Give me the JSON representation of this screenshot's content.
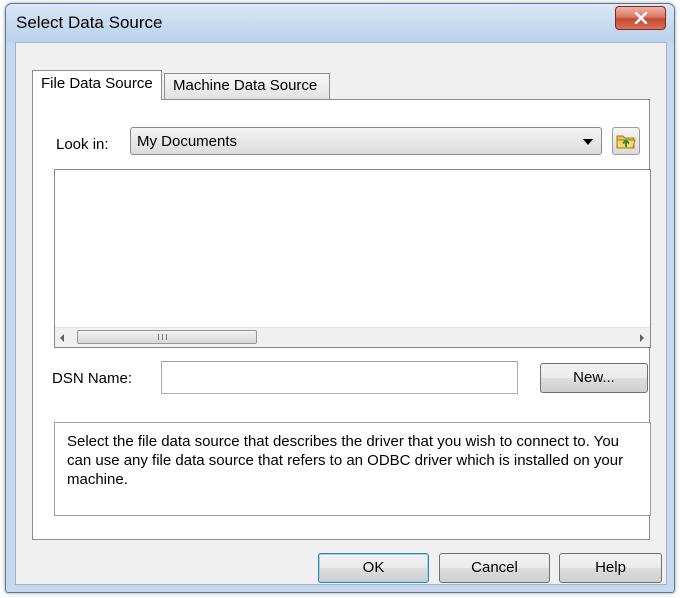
{
  "window": {
    "title": "Select Data Source"
  },
  "tabs": [
    {
      "label": "File Data Source",
      "selected": true
    },
    {
      "label": "Machine Data Source",
      "selected": false
    }
  ],
  "look_in": {
    "label": "Look in:",
    "value": "My Documents"
  },
  "file_list": {
    "items": [],
    "scrollbar_grip": "III"
  },
  "dsn": {
    "label": "DSN Name:",
    "value": "",
    "new_button": "New..."
  },
  "description": "Select the file data source that describes the driver that you wish to connect to. You can use any file data source that refers to an ODBC driver which is installed on your machine.",
  "buttons": {
    "ok": "OK",
    "cancel": "Cancel",
    "help": "Help"
  },
  "icons": {
    "close": "close-icon",
    "dropdown": "chevron-down-icon",
    "up_folder": "up-folder-icon"
  }
}
